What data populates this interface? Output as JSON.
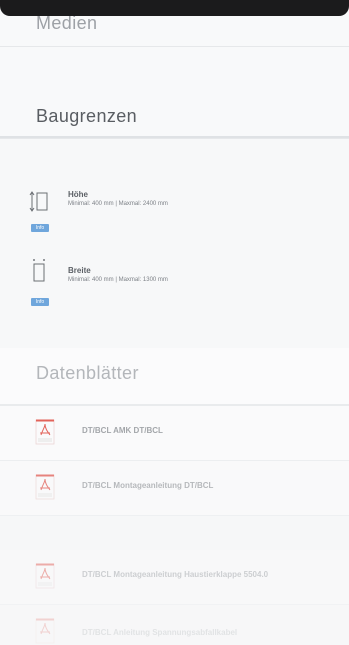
{
  "sections": {
    "medien": {
      "title": "Medien"
    },
    "baugrenzen": {
      "title": "Baugrenzen",
      "items": [
        {
          "name": "Höhe",
          "detail": "Minimal: 400 mm | Maxmal: 2400 mm",
          "badge": "Info",
          "icon": "height-dimension-icon"
        },
        {
          "name": "Breite",
          "detail": "Minimal: 400 mm | Maxmal: 1300 mm",
          "badge": "Info",
          "icon": "width-dimension-icon"
        }
      ]
    },
    "datasheets": {
      "title": "Datenblätter",
      "items": [
        {
          "label": "DT/BCL AMK DT/BCL",
          "icon": "pdf-file-icon"
        },
        {
          "label": "DT/BCL Montageanleitung DT/BCL",
          "icon": "pdf-file-icon"
        },
        {
          "label": "DT/BCL Montageanleitung Haustierklappe 5504.0",
          "icon": "pdf-file-icon"
        },
        {
          "label": "DT/BCL Anleitung Spannungsabfallkabel",
          "icon": "pdf-file-icon"
        }
      ]
    }
  },
  "colors": {
    "accent_info": "#6fa6dc",
    "pdf_red": "#e0534a",
    "topbar": "#1b1b1c"
  }
}
